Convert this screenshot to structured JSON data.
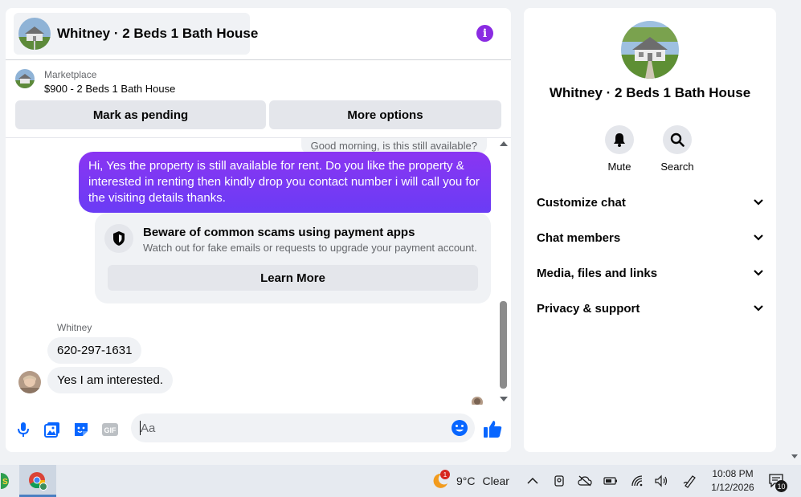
{
  "chat": {
    "title": "Whitney · 2 Beds 1 Bath House",
    "marketplace": {
      "label": "Marketplace",
      "listing": "$900 - 2 Beds 1 Bath House"
    },
    "buttons": {
      "mark_pending": "Mark as pending",
      "more_options": "More options"
    },
    "messages": {
      "previous_preview": "Good morning, is this still available?",
      "outgoing": "Hi, Yes the property is still available for rent. Do you like the property & interested in renting then kindly drop you contact number i will call you for the visiting details thanks.",
      "scam_notice": {
        "title": "Beware of common scams using payment apps",
        "subtitle": "Watch out for fake emails or requests to upgrade your payment account.",
        "button": "Learn More"
      },
      "sender_name": "Whitney",
      "incoming": [
        "620-297-1631",
        "Yes I am interested."
      ]
    },
    "composer": {
      "placeholder": "Aa"
    }
  },
  "info_panel": {
    "name": "Whitney · 2 Beds 1 Bath House",
    "actions": {
      "mute": "Mute",
      "search": "Search"
    },
    "sections": [
      "Customize chat",
      "Chat members",
      "Media, files and links",
      "Privacy & support"
    ]
  },
  "taskbar": {
    "weather": {
      "temp": "9°C",
      "condition": "Clear",
      "badge": "1"
    },
    "time": "10:08 PM",
    "date": "1/12/2026",
    "notification_count": "10"
  },
  "colors": {
    "accent_purple": "#7b3ff2",
    "info_icon": "#8a2be2",
    "composer_blue": "#0866ff",
    "panel_bg": "#f0f2f5"
  }
}
